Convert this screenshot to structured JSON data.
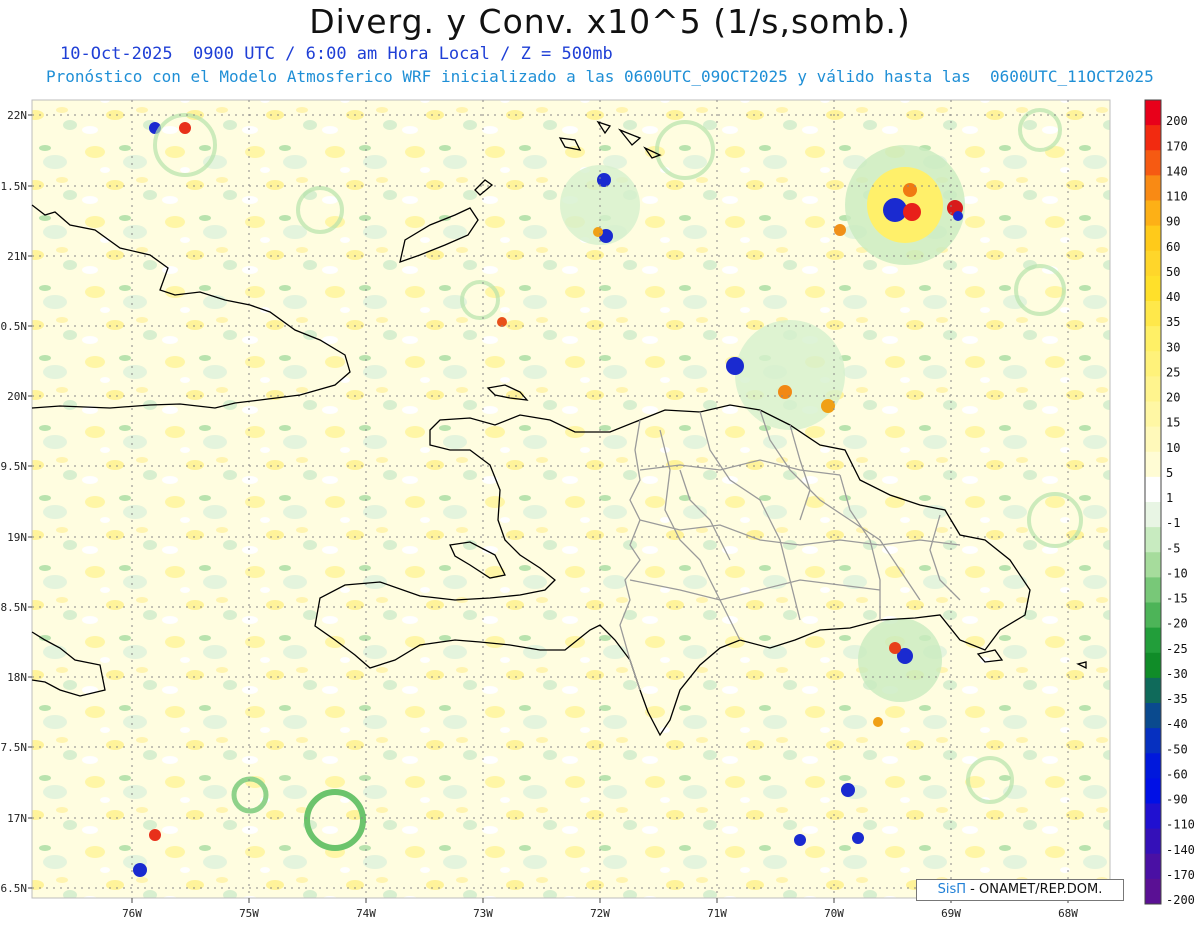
{
  "header": {
    "title": "Diverg. y Conv. x10^5 (1/s,somb.)",
    "line1": "10-Oct-2025  0900 UTC / 6:00 am Hora Local / Z = 500mb",
    "line2": "Pronóstico con el Modelo Atmosferico WRF inicializado a las 0600UTC_09OCT2025 y válido hasta las  0600UTC_11OCT2025"
  },
  "map": {
    "lat_labels": [
      "22N",
      "1.5N",
      "21N",
      "0.5N",
      "20N",
      "9.5N",
      "19N",
      "8.5N",
      "18N",
      "7.5N",
      "17N",
      "6.5N"
    ],
    "lon_labels": [
      "76W",
      "75W",
      "74W",
      "73W",
      "72W",
      "71W",
      "70W",
      "69W",
      "68W"
    ]
  },
  "colorbar": {
    "labels": [
      "200",
      "170",
      "140",
      "110",
      "90",
      "60",
      "50",
      "40",
      "35",
      "30",
      "25",
      "20",
      "15",
      "10",
      "5",
      "1",
      "-1",
      "-5",
      "-10",
      "-15",
      "-20",
      "-25",
      "-30",
      "-35",
      "-40",
      "-50",
      "-60",
      "-90",
      "-110",
      "-140",
      "-170",
      "-200"
    ],
    "colors": [
      "#e8001a",
      "#f22a10",
      "#f65a12",
      "#f98a14",
      "#fdb016",
      "#ffca1a",
      "#ffd62a",
      "#ffe02a",
      "#ffe84a",
      "#fff066",
      "#fff27a",
      "#fff48e",
      "#fff7a4",
      "#fff9ba",
      "#fffcd4",
      "#ffffff",
      "#e8f5e4",
      "#c8ebc0",
      "#a6dc9c",
      "#78c878",
      "#4db458",
      "#229e3a",
      "#108c28",
      "#0f6a5a",
      "#0a4a8e",
      "#0630c0",
      "#0018dc",
      "#0010e6",
      "#2010d0",
      "#3410b8",
      "#4a10a4",
      "#5a1094"
    ]
  },
  "credit": {
    "brand": "SisΠ",
    "text": " - ONAMET/REP.DOM."
  }
}
